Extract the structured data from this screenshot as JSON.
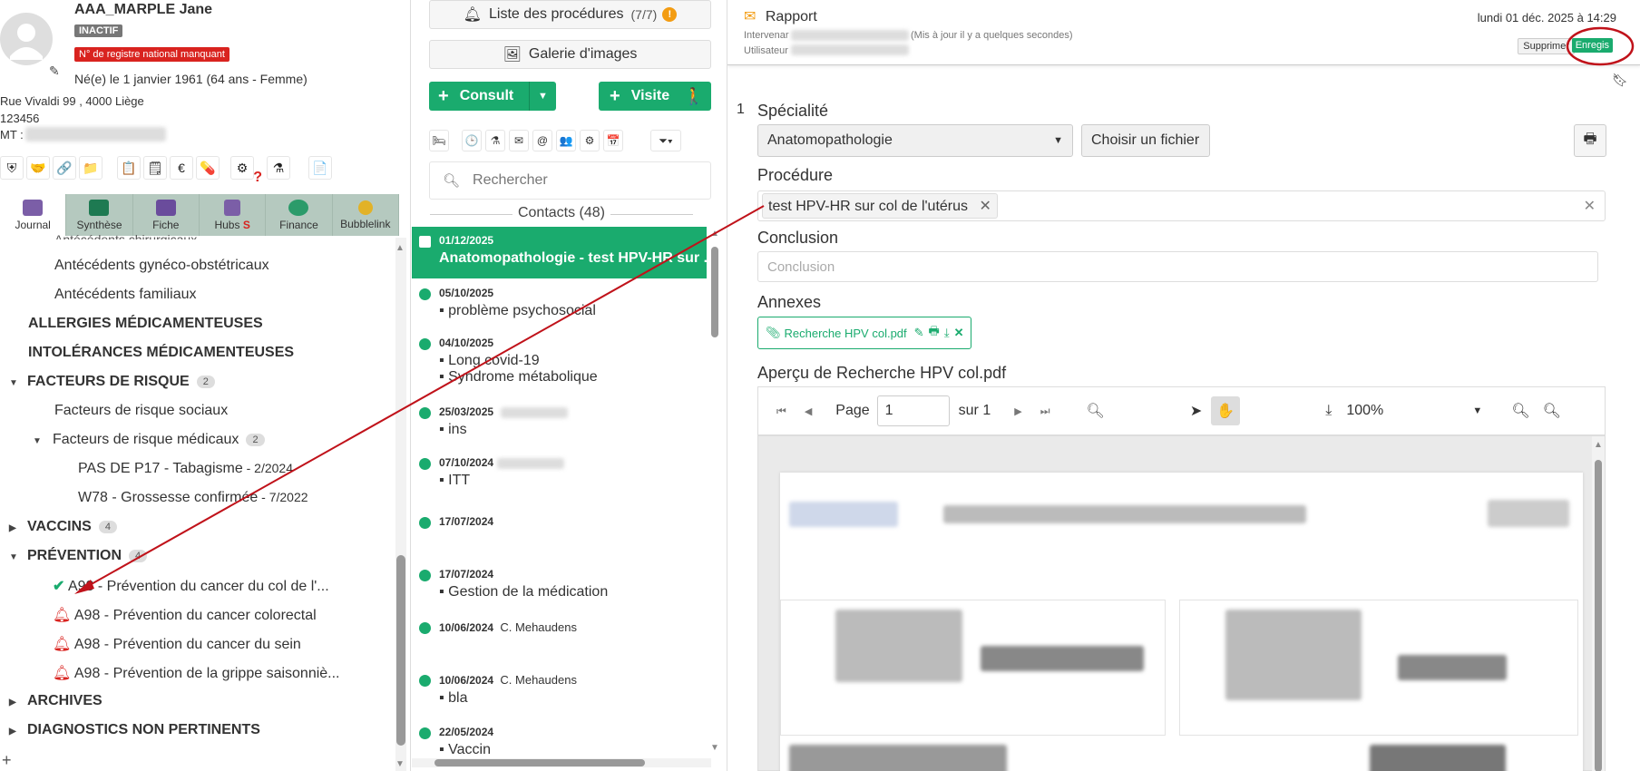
{
  "patient": {
    "name": "AAA_MARPLE Jane",
    "status_badge": "INACTIF",
    "warning_badge": "N° de registre national manquant",
    "birth": "Né(e) le 1 janvier 1961 (64 ans - Femme)",
    "address": "Rue Vivaldi 99 , 4000 Liège",
    "phone": "123456",
    "mt_label": "MT :"
  },
  "nav_tabs": [
    {
      "label": "Journal",
      "color": "#7b5ea7"
    },
    {
      "label": "Synthèse",
      "color": "#1e7a52"
    },
    {
      "label": "Fiche",
      "color": "#6a4c9c"
    },
    {
      "label": "Hubs",
      "color": "#7b5ea7",
      "extra": "S"
    },
    {
      "label": "Finance",
      "color": "#2b9b6a"
    },
    {
      "label": "Bubblelink",
      "color": "#e2b227"
    }
  ],
  "tree": {
    "items": [
      {
        "label": "Antécédents gynéco-obstétricaux"
      },
      {
        "label": "Antécédents familiaux"
      },
      {
        "label": "ALLERGIES MÉDICAMENTEUSES"
      },
      {
        "label": "INTOLÉRANCES MÉDICAMENTEUSES"
      },
      {
        "label": "FACTEURS DE RISQUE",
        "count": "2"
      },
      {
        "label": "Facteurs de risque sociaux"
      },
      {
        "label": "Facteurs de risque médicaux",
        "count": "2"
      },
      {
        "label": "PAS DE P17 - Tabagisme",
        "suffix": " - 2/2024"
      },
      {
        "label": "W78 - Grossesse confirmée",
        "suffix": " - 7/2022"
      },
      {
        "label": "VACCINS",
        "count": "4"
      },
      {
        "label": "PRÉVENTION",
        "count": "4"
      },
      {
        "label": "A98 - Prévention du cancer du col de l'..."
      },
      {
        "label": "A98 - Prévention du cancer colorectal"
      },
      {
        "label": "A98 - Prévention du cancer du sein"
      },
      {
        "label": "A98 - Prévention de la grippe saisonniè..."
      },
      {
        "label": "ARCHIVES"
      },
      {
        "label": "DIAGNOSTICS NON PERTINENTS"
      }
    ]
  },
  "middle": {
    "procedures_label": "Liste des procédures",
    "procedures_count": "(7/7)",
    "gallery_label": "Galerie d'images",
    "consult_label": "Consult",
    "visit_label": "Visite",
    "search_placeholder": "Rechercher",
    "contacts_label": "Contacts (48)",
    "contacts": [
      {
        "date": "01/12/2025",
        "title": "Anatomopathologie - test HPV-HR sur ...",
        "author": ""
      },
      {
        "date": "05/10/2025",
        "title": "problème psychosocial",
        "author": ""
      },
      {
        "date": "04/10/2025",
        "title": "Long covid-19",
        "title2": "Syndrome métabolique",
        "author": ""
      },
      {
        "date": "25/03/2025",
        "title": "ins",
        "author": ""
      },
      {
        "date": "07/10/2024",
        "title": "ITT",
        "author": ""
      },
      {
        "date": "17/07/2024",
        "title": "",
        "author": ""
      },
      {
        "date": "17/07/2024",
        "title": "Gestion de la médication",
        "author": ""
      },
      {
        "date": "10/06/2024",
        "title": "",
        "author": "C. Mehaudens"
      },
      {
        "date": "10/06/2024",
        "title": "bla",
        "author": "C. Mehaudens"
      },
      {
        "date": "22/05/2024",
        "title": "Vaccin",
        "author": ""
      }
    ]
  },
  "report": {
    "title": "Rapport",
    "datetime": "lundi 01 déc. 2025 à 14:29",
    "intervenant_label": "Intervenar",
    "saved_note": "(Mis à jour il y a quelques secondes)",
    "user_label": "Utilisateur",
    "delete_label": "Supprimer",
    "save_label": "Enregis",
    "index": "1",
    "specialty_label": "Spécialité",
    "specialty_value": "Anatomopathologie",
    "file_button": "Choisir un fichier",
    "procedure_label": "Procédure",
    "procedure_tag": "test HPV-HR sur col de l'utérus",
    "conclusion_label": "Conclusion",
    "conclusion_placeholder": "Conclusion",
    "annexes_label": "Annexes",
    "annex_file": "Recherche HPV col.pdf",
    "preview_label": "Aperçu de Recherche HPV col.pdf",
    "pdf": {
      "page_label": "Page",
      "page_value": "1",
      "of_label": "sur 1",
      "zoom": "100%"
    }
  },
  "colors": {
    "green": "#1aab6e",
    "red": "#d9231f",
    "annotation": "#c0121a"
  }
}
